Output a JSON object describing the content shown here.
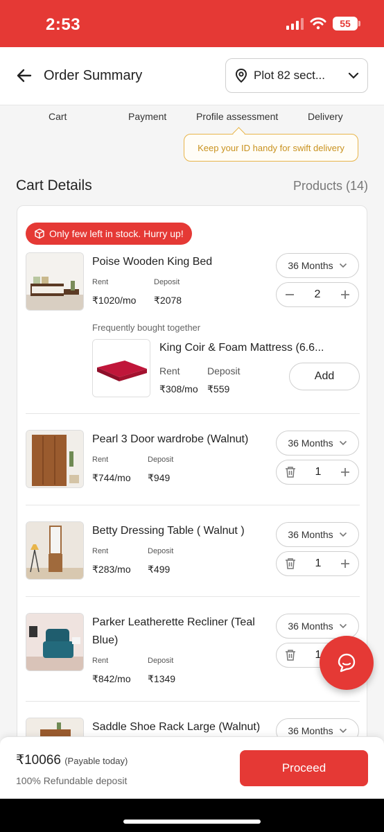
{
  "status_bar": {
    "time": "2:53",
    "battery": "55"
  },
  "header": {
    "title": "Order Summary",
    "location": "Plot 82 sect..."
  },
  "steps": [
    "Cart",
    "Payment",
    "Profile assessment",
    "Delivery"
  ],
  "tooltip": "Keep your ID handy for swift delivery",
  "cart": {
    "title": "Cart Details",
    "products_count": "Products (14)"
  },
  "stock_badge": "Only few left in stock. Hurry up!",
  "labels": {
    "rent": "Rent",
    "deposit": "Deposit",
    "fbt": "Frequently bought together",
    "add": "Add"
  },
  "items": [
    {
      "name": "Poise Wooden King Bed",
      "rent": "₹1020/mo",
      "deposit": "₹2078",
      "tenure": "36 Months",
      "qty": "2"
    },
    {
      "name": "Pearl 3 Door wardrobe (Walnut)",
      "rent": "₹744/mo",
      "deposit": "₹949",
      "tenure": "36 Months",
      "qty": "1"
    },
    {
      "name": "Betty Dressing Table ( Walnut )",
      "rent": "₹283/mo",
      "deposit": "₹499",
      "tenure": "36 Months",
      "qty": "1"
    },
    {
      "name": "Parker Leatherette Recliner (Teal Blue)",
      "rent": "₹842/mo",
      "deposit": "₹1349",
      "tenure": "36 Months",
      "qty": "1"
    },
    {
      "name": "Saddle Shoe Rack Large (Walnut)",
      "tenure": "36 Months"
    }
  ],
  "fbt_item": {
    "name": "King Coir & Foam Mattress (6.6...",
    "rent": "₹308/mo",
    "deposit": "₹559"
  },
  "footer": {
    "total": "₹10066",
    "payable": "(Payable today)",
    "refund": "100% Refundable deposit",
    "proceed": "Proceed"
  },
  "colors": {
    "brand_red": "#e53935",
    "tooltip_gold": "#e8b54a"
  }
}
